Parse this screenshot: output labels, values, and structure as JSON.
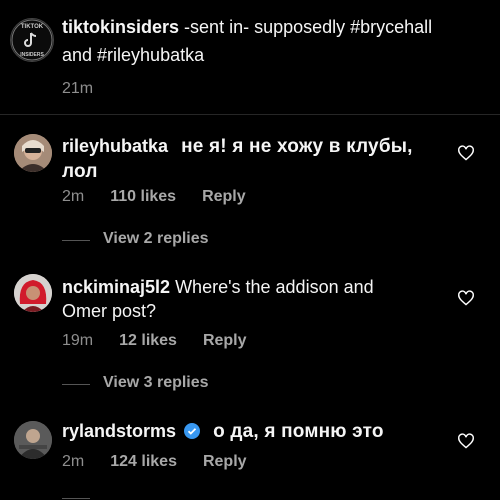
{
  "post": {
    "username": "tiktokinsiders",
    "caption_line1": " -sent in- supposedly #brycehall",
    "caption_line2": "and #rileyhubatka",
    "time": "21m",
    "avatar_text_top": "TIKTOK",
    "avatar_text_bottom": "INSIDERS"
  },
  "comments": [
    {
      "username": "rileyhubatka",
      "text_line1": "не я! я не хожу в клубы,",
      "text_line2": "лол",
      "time": "2m",
      "likes": "110 likes",
      "reply": "Reply",
      "view_replies": "View 2 replies"
    },
    {
      "username": "nckiminaj5l2",
      "text_line1": " Where's the addison and",
      "text_line2": "Omer post?",
      "time": "19m",
      "likes": "12 likes",
      "reply": "Reply",
      "view_replies": "View 3 replies"
    },
    {
      "username": "rylandstorms",
      "text_line1": "о да, я помню это",
      "time": "2m",
      "likes": "124 likes",
      "reply": "Reply",
      "verified": true
    }
  ],
  "colors": {
    "background": "#000000",
    "muted": "#8e8e8e",
    "verified": "#3897f0"
  },
  "icons": [
    "heart-icon",
    "verified-badge-icon"
  ]
}
